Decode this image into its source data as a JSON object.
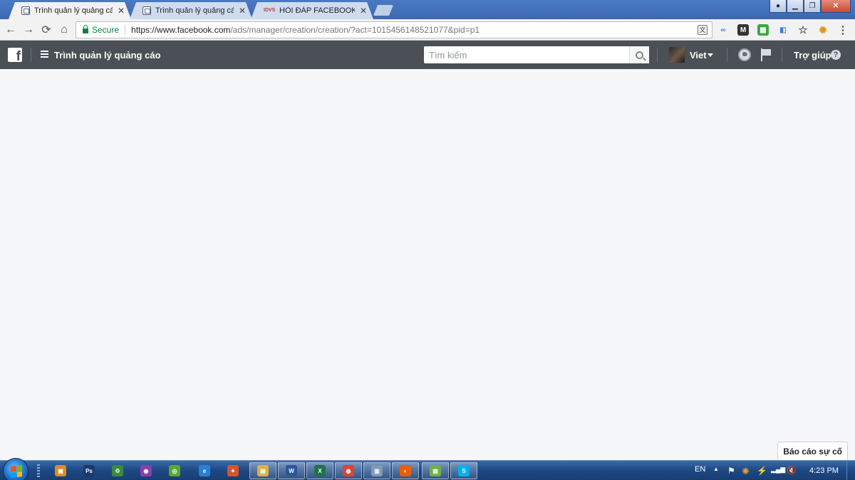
{
  "browser": {
    "tabs": [
      {
        "title": "Trình quản lý quảng cáo",
        "favicon": "page-icon",
        "active": true
      },
      {
        "title": "Trình quản lý quảng cáo",
        "favicon": "page-icon",
        "active": false
      },
      {
        "title": "HỎI ĐÁP FACEBOOK AD",
        "favicon": "idvs-logo",
        "active": false
      }
    ],
    "tab_close": "✕",
    "idvs_logo_text": "IDVS",
    "window_controls": {
      "minimize": "▁",
      "restore": "❐",
      "close": "✕"
    },
    "nav": {
      "back": "←",
      "forward": "→",
      "reload": "⟳",
      "home": "⌂"
    },
    "omnibox": {
      "secure_label": "Secure",
      "url_host": "https://www.facebook.com",
      "url_path": "/ads/manager/creation/creation/?act=1015456148521077&pid=p1"
    },
    "translate_glyph": "文",
    "extensions": {
      "link": "∞",
      "mail": "M",
      "grid": "▦",
      "box": "◧",
      "star": "☆",
      "puzzle": "✹",
      "menu": "⋮"
    }
  },
  "fb_header": {
    "logo_letter": "f",
    "app_title": "Trình quản lý quảng cáo",
    "search_placeholder": "Tìm kiếm",
    "user_name": "Viet",
    "help_label": "Trợ giúp",
    "help_glyph": "?"
  },
  "content": {
    "report_problem_label": "Báo cáo sự cố"
  },
  "taskbar": {
    "apps": [
      {
        "name": "paint-app-icon",
        "glyph": "▣",
        "color": "#e08a2a"
      },
      {
        "name": "photoshop-app-icon",
        "glyph": "Ps",
        "color": "#1b3a6b"
      },
      {
        "name": "recycle-app-icon",
        "glyph": "♲",
        "color": "#3a8a3a"
      },
      {
        "name": "purple-app-icon",
        "glyph": "◉",
        "color": "#8a3fb0"
      },
      {
        "name": "green-swirl-app-icon",
        "glyph": "◎",
        "color": "#5aa832"
      },
      {
        "name": "internet-explorer-app-icon",
        "glyph": "e",
        "color": "#2a7fd4"
      },
      {
        "name": "network-app-icon",
        "glyph": "✦",
        "color": "#d4552a"
      },
      {
        "name": "explorer-app-icon",
        "glyph": "▤",
        "color": "#d9b24a"
      },
      {
        "name": "word-app-icon",
        "glyph": "W",
        "color": "#2b579a"
      },
      {
        "name": "excel-app-icon",
        "glyph": "X",
        "color": "#217346"
      },
      {
        "name": "chrome-app-icon",
        "glyph": "◍",
        "color": "#db4437"
      },
      {
        "name": "notepad-app-icon",
        "glyph": "▥",
        "color": "#7f9ab8"
      },
      {
        "name": "firefox-app-icon",
        "glyph": "◐",
        "color": "#e66000"
      },
      {
        "name": "messenger-app-icon",
        "glyph": "▧",
        "color": "#6fb04a"
      },
      {
        "name": "skype-app-icon",
        "glyph": "S",
        "color": "#00aff0"
      }
    ],
    "language": "EN",
    "clock": "4:23 PM",
    "tray_glyphs": {
      "arrow": "▲",
      "flag": "⚑",
      "star": "✺",
      "power": "⚡",
      "signal": "▂▄▆",
      "volume": "🔇"
    }
  }
}
